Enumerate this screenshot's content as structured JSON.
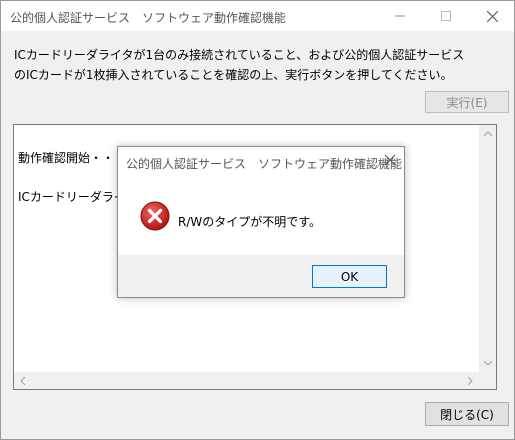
{
  "window": {
    "title": "公的個人認証サービス　ソフトウェア動作確認機能",
    "controls": {
      "minimize_icon": "minimize-icon",
      "maximize_icon": "maximize-icon",
      "close_icon": "close-icon"
    }
  },
  "main": {
    "message_line1": "ICカードリーダライタが1台のみ接続されていること、および公的個人認証サービス",
    "message_line2": "のICカードが1枚挿入されていることを確認の上、実行ボタンを押してください。",
    "run_button": "実行(E)",
    "log": [
      "動作確認開始・・・・・",
      "ICカードリーダライタ基本動作確認"
    ],
    "close_button": "閉じる(C)"
  },
  "dialog": {
    "title": "公的個人認証サービス　ソフトウェア動作確認機能",
    "icon": "error-icon",
    "message": "R/Wのタイプが不明です。",
    "ok_button": "OK"
  }
}
